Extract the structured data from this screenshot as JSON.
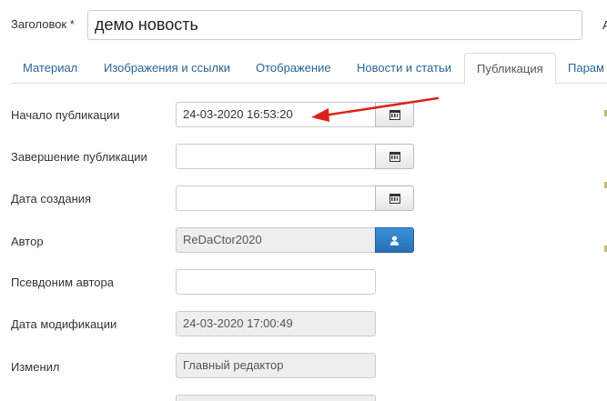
{
  "title": {
    "label": "Заголовок *",
    "value": "демо новость",
    "right_clip": "А"
  },
  "tabs": [
    {
      "label": "Материал",
      "active": false
    },
    {
      "label": "Изображения и ссылки",
      "active": false
    },
    {
      "label": "Отображение",
      "active": false
    },
    {
      "label": "Новости и статьи",
      "active": false
    },
    {
      "label": "Публикация",
      "active": true
    },
    {
      "label": "Парам",
      "active": false
    }
  ],
  "fields": {
    "publish_up": {
      "label": "Начало публикации",
      "value": "24-03-2020 16:53:20",
      "button_icon": "calendar-icon"
    },
    "publish_down": {
      "label": "Завершение публикации",
      "value": "",
      "button_icon": "calendar-icon"
    },
    "created": {
      "label": "Дата создания",
      "value": "",
      "button_icon": "calendar-icon"
    },
    "author": {
      "label": "Автор",
      "value": "ReDaCtor2020",
      "button_icon": "user-icon"
    },
    "author_alias": {
      "label": "Псевдоним автора",
      "value": ""
    },
    "modified": {
      "label": "Дата модификации",
      "value": "24-03-2020 17:00:49"
    },
    "modified_by": {
      "label": "Изменил",
      "value": "Главный редактор"
    }
  },
  "colors": {
    "tab_link": "#2a6496",
    "annotation_arrow": "#d9241b",
    "author_button": "#2f7fc8"
  }
}
